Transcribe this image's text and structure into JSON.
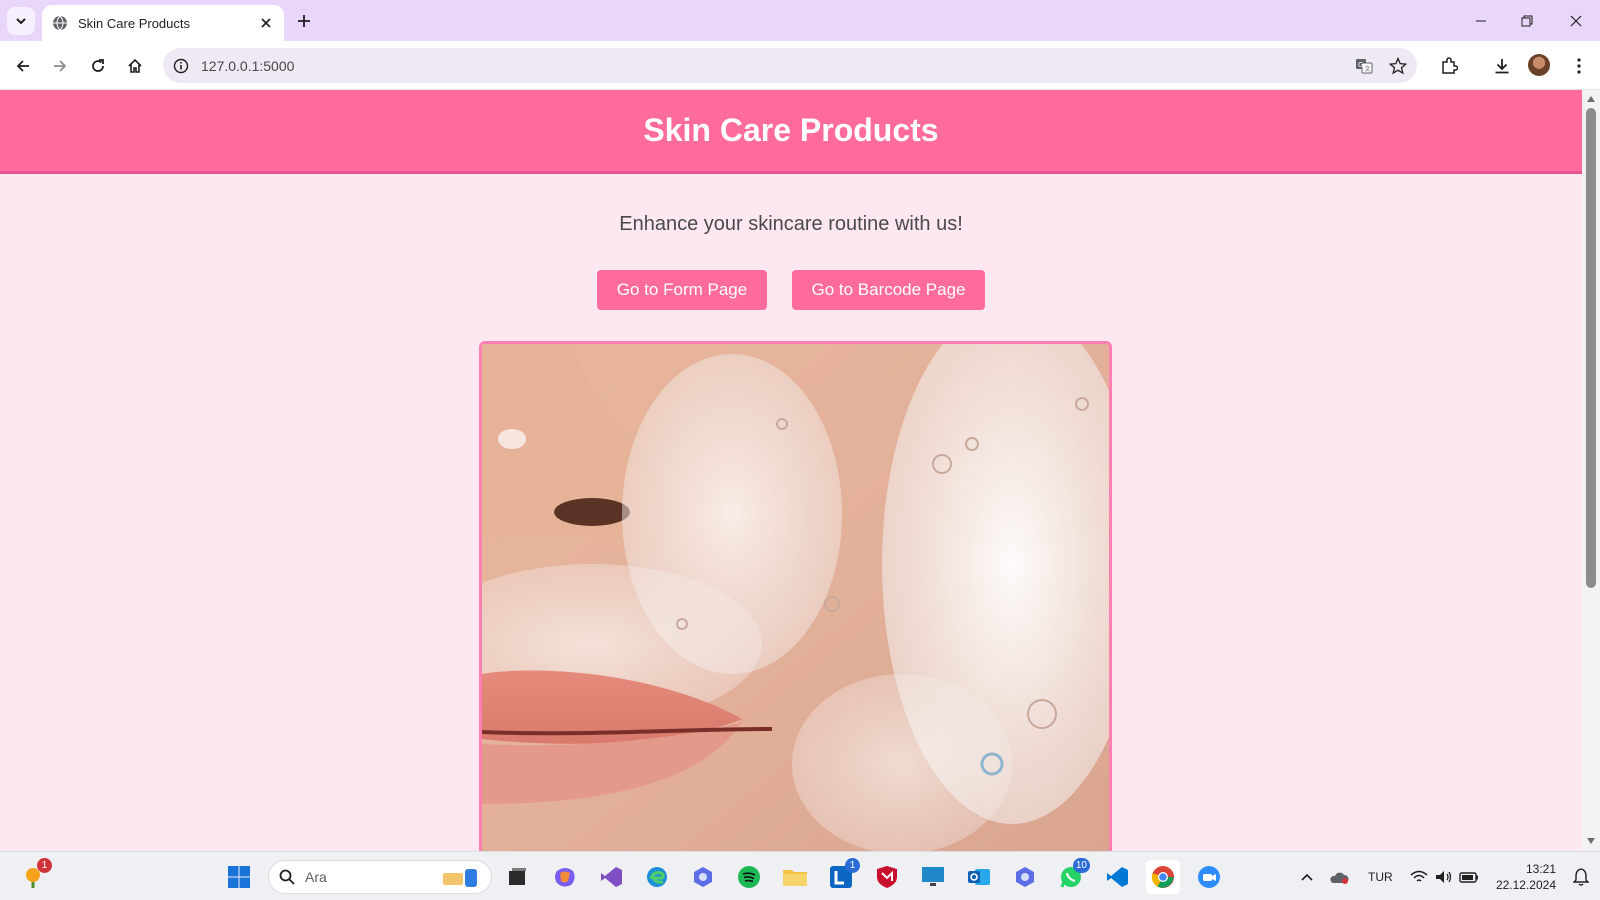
{
  "browser": {
    "tab": {
      "title": "Skin Care Products",
      "favicon": "globe-icon"
    },
    "address": {
      "url": "127.0.0.1:5000"
    },
    "icons": [
      "tab-search-icon",
      "close-icon",
      "plus-icon",
      "minimize-icon",
      "restore-icon",
      "window-close-icon",
      "back-icon",
      "forward-icon",
      "reload-icon",
      "home-icon",
      "site-info-icon",
      "translate-icon",
      "star-icon",
      "extensions-icon",
      "download-icon",
      "menu-icon"
    ]
  },
  "page": {
    "title": "Skin Care Products",
    "tagline": "Enhance your skincare routine with us!",
    "buttons": {
      "form": "Go to Form Page",
      "barcode": "Go to Barcode Page"
    },
    "colors": {
      "header": "#ff6b9d",
      "background": "#fde7f1",
      "button": "#ff6b9d"
    }
  },
  "taskbar": {
    "search_placeholder": "Ara",
    "badges": {
      "notify": "1",
      "linkedin": "1",
      "whatsapp": "10"
    },
    "tray": {
      "language": "TUR",
      "time": "13:21",
      "date": "22.12.2024"
    }
  }
}
